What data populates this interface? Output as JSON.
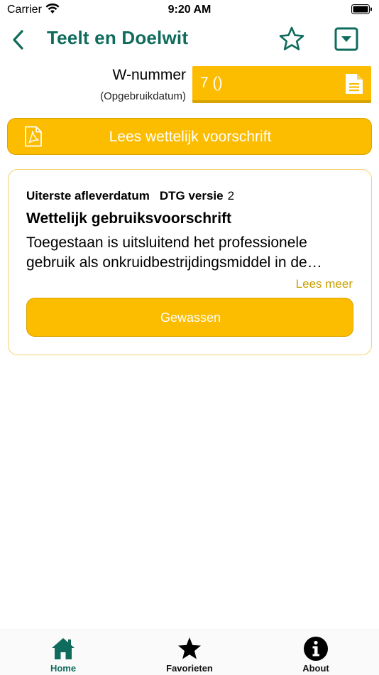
{
  "status_bar": {
    "carrier": "Carrier",
    "time": "9:20 AM"
  },
  "nav": {
    "title": "Teelt en Doelwit",
    "back_icon": "chevron-left-icon",
    "favorite_icon": "star-outline-icon",
    "dropdown_icon": "dropdown-square-icon"
  },
  "w_nummer": {
    "label": "W-nummer",
    "sublabel": "(Opgebruikdatum)",
    "value": "7 ()",
    "icon": "document-icon"
  },
  "pdf_button": {
    "label": "Lees wettelijk voorschrift",
    "icon": "pdf-icon"
  },
  "card": {
    "meta_key": "Uiterste afleverdatum",
    "meta_key2": "DTG versie",
    "meta_value": "2",
    "title": "Wettelijk gebruiksvoorschrift",
    "body": "Toegestaan is uitsluitend het professionele gebruik als onkruidbestrijdingsmiddel in de…",
    "read_more": "Lees meer",
    "crops_button": "Gewassen"
  },
  "tabs": [
    {
      "label": "Home",
      "icon": "home-icon",
      "active": true
    },
    {
      "label": "Favorieten",
      "icon": "star-icon",
      "active": false
    },
    {
      "label": "About",
      "icon": "info-icon",
      "active": false
    }
  ],
  "colors": {
    "accent_green": "#0f6b5c",
    "brand_yellow": "#fcbc00",
    "link_yellow": "#c9a000"
  }
}
